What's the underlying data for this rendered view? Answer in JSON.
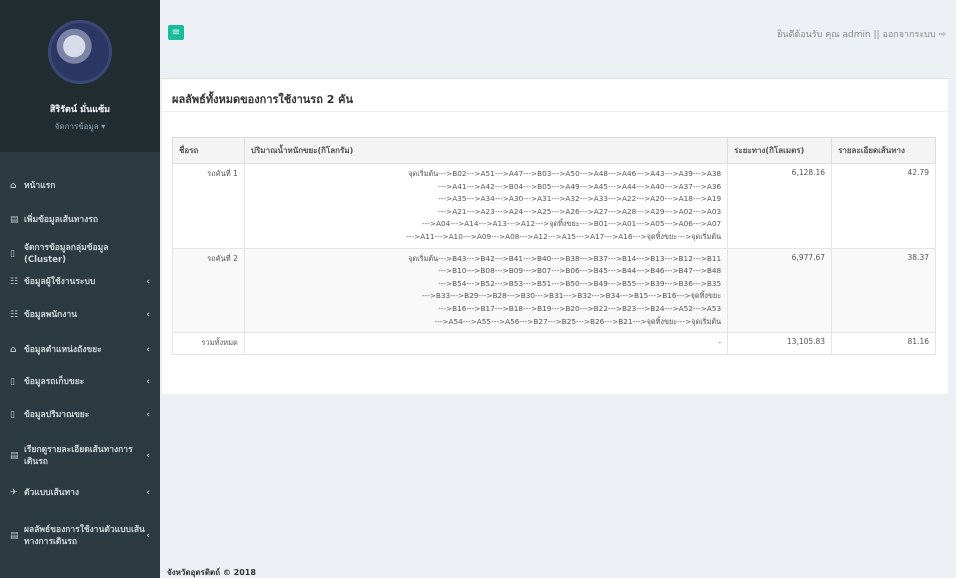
{
  "sidebar": {
    "user_name": "สิริรัตน์ มั่นแซ้ม",
    "user_role": "จัดการข้อมูล ▾",
    "items": [
      {
        "icon": "home-icon",
        "glyph": "⌂",
        "label": "หน้าแรก",
        "chevron": ""
      },
      {
        "icon": "form-icon",
        "glyph": "▤",
        "label": "เพิ่มข้อมูลเส้นทางรถ",
        "chevron": ""
      },
      {
        "icon": "file-icon",
        "glyph": "▯",
        "label": "จัดการข้อมูลกลุ่มข้อมูล (Cluster)",
        "chevron": ""
      },
      {
        "icon": "users-icon",
        "glyph": "☷",
        "label": "ข้อมูลผู้ใช้งานระบบ",
        "chevron": "‹"
      },
      {
        "icon": "staff-icon",
        "glyph": "☷",
        "label": "ข้อมูลพนักงาน",
        "chevron": "‹"
      },
      {
        "icon": "location-icon",
        "glyph": "⌂",
        "label": "ข้อมูลตำแหน่งถังขยะ",
        "chevron": "‹"
      },
      {
        "icon": "truck-icon",
        "glyph": "▯",
        "label": "ข้อมูลรถเก็บขยะ",
        "chevron": "‹"
      },
      {
        "icon": "garbage-icon",
        "glyph": "▯",
        "label": "ข้อมูลปริมาณขยะ",
        "chevron": "‹"
      },
      {
        "icon": "report-icon",
        "glyph": "▤",
        "label": "เรียกดูรายละเอียดเส้นทางการเดินรถ",
        "chevron": "‹"
      },
      {
        "icon": "map-icon",
        "glyph": "✈",
        "label": "ตัวแบบเส้นทาง",
        "chevron": "‹"
      },
      {
        "icon": "chart-icon",
        "glyph": "▤",
        "label": "ผลลัพธ์ของการใช้งานตัวแบบเส้นทางการเดินรถ",
        "chevron": "‹"
      }
    ]
  },
  "topbar": {
    "toggle": "≡",
    "welcome": "ยินดีต้อนรับ คุณ admin || ออกจากระบบ ⇨"
  },
  "panel": {
    "title": "ผลลัพธ์ทั้งหมดของการใช้งานรถ 2 คัน",
    "columns": [
      "ชื่อรถ",
      "ปริมาณน้ำหนักขยะ(กิโลกรัม)",
      "ระยะทาง(กิโลเมตร)",
      "รายละเอียดเส้นทาง"
    ],
    "rows": [
      {
        "car": "รถคันที่ 1",
        "route": [
          "จุดเริ่มต้น--->B02--->A51--->A47--->B03--->A50--->A48--->A46--->A43--->A39--->A38",
          "--->A41--->A42--->B04--->B05--->A49--->A45--->A44--->A40--->A37--->A36",
          "--->A35--->A34--->A30--->A31--->A32--->A33--->A22--->A20--->A18--->A19",
          "--->A21--->A23--->A24--->A25--->A26--->A27--->A28--->A29--->A02--->A03",
          "--->A04--->A14--->A13--->A12--->จุดทิ้งขยะ--->B01--->A01--->A05--->A06--->A07",
          "--->A11--->A10--->A09--->A08--->A12--->A15--->A17--->A16--->จุดทิ้งขยะ--->จุดเริ่มต้น"
        ],
        "distance": "6,128.16",
        "detail": "42.79"
      },
      {
        "car": "รถคันที่ 2",
        "route": [
          "จุดเริ่มต้น--->B43--->B42--->B41--->B40--->B38--->B37--->B14--->B13--->B12--->B11",
          "--->B10--->B08--->B09--->B07--->B06--->B45--->B44--->B46--->B47--->B48",
          "--->B54--->B52--->B53--->B51--->B50--->B49--->B55--->B39--->B36--->B35",
          "--->B33--->B29--->B28--->B30--->B31--->B32--->B34--->B15--->B16--->จุดทิ้งขยะ",
          "--->B16--->B17--->B18--->B19--->B20--->B22--->B23--->B24--->A52--->A53",
          "--->A54--->A55--->A56--->B27--->B25--->B26--->B21--->จุดทิ้งขยะ--->จุดเริ่มต้น"
        ],
        "distance": "6,977.67",
        "detail": "38.37"
      },
      {
        "car": "รวมทั้งหมด",
        "route": [
          "-"
        ],
        "distance": "13,105.83",
        "detail": "81.16"
      }
    ]
  },
  "footer": {
    "text": "จังหวัดอุตรดิตถ์ © 2018"
  }
}
